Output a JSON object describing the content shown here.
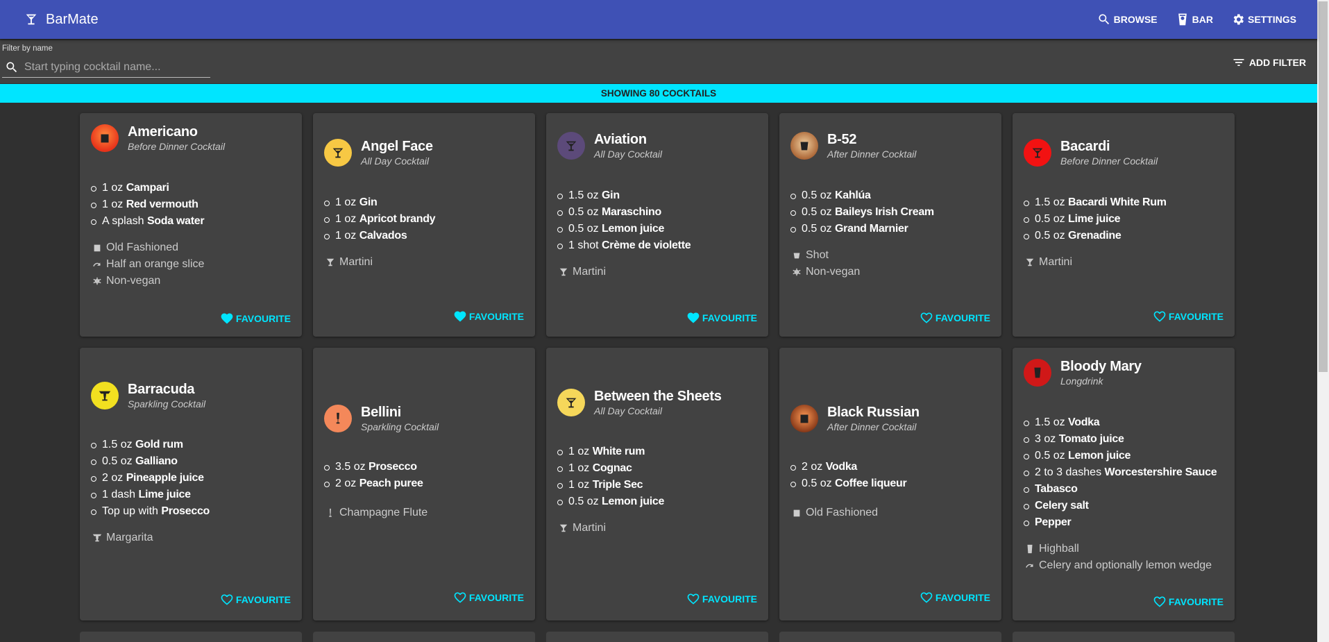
{
  "app": {
    "title": "BarMate"
  },
  "nav": [
    {
      "label": "BROWSE",
      "icon": "search-icon"
    },
    {
      "label": "BAR",
      "icon": "cup-icon"
    },
    {
      "label": "SETTINGS",
      "icon": "gear-icon"
    }
  ],
  "filter": {
    "label": "Filter by name",
    "placeholder": "Start typing cocktail name...",
    "add_filter": "ADD FILTER"
  },
  "banner": "SHOWING 80 COCKTAILS",
  "favourite_label": "FAVOURITE",
  "colors": {
    "appbar": "#3f51b5",
    "accent": "#00e5ff",
    "card": "#424242",
    "background": "#303030"
  },
  "cards": [
    {
      "name": "Americano",
      "category": "Before Dinner Cocktail",
      "glass_icon": "old-fashioned-glass-icon",
      "ingredients": [
        [
          "1 oz ",
          "Campari"
        ],
        [
          "1 oz ",
          "Red vermouth"
        ],
        [
          "A splash ",
          "Soda water"
        ]
      ],
      "meta": [
        [
          "glass",
          "Old Fashioned"
        ],
        [
          "garnish",
          "Half an orange slice"
        ],
        [
          "vegan",
          "Non-vegan"
        ]
      ],
      "favourite": true
    },
    {
      "name": "Angel Face",
      "category": "All Day Cocktail",
      "glass_icon": "martini-glass-icon",
      "ingredients": [
        [
          "1 oz ",
          "Gin"
        ],
        [
          "1 oz ",
          "Apricot brandy"
        ],
        [
          "1 oz ",
          "Calvados"
        ]
      ],
      "meta": [
        [
          "martini",
          "Martini"
        ]
      ],
      "favourite": true
    },
    {
      "name": "Aviation",
      "category": "All Day Cocktail",
      "glass_icon": "martini-glass-icon",
      "ingredients": [
        [
          "1.5 oz ",
          "Gin"
        ],
        [
          "0.5 oz ",
          "Maraschino"
        ],
        [
          "0.5 oz ",
          "Lemon juice"
        ],
        [
          "1 shot ",
          "Crème de violette"
        ]
      ],
      "meta": [
        [
          "martini",
          "Martini"
        ]
      ],
      "favourite": true
    },
    {
      "name": "B-52",
      "category": "After Dinner Cocktail",
      "glass_icon": "shot-glass-icon",
      "ingredients": [
        [
          "0.5 oz ",
          "Kahlúa"
        ],
        [
          "0.5 oz ",
          "Baileys Irish Cream"
        ],
        [
          "0.5 oz ",
          "Grand Marnier"
        ]
      ],
      "meta": [
        [
          "shot",
          "Shot"
        ],
        [
          "vegan",
          "Non-vegan"
        ]
      ],
      "favourite": false
    },
    {
      "name": "Bacardi",
      "category": "Before Dinner Cocktail",
      "glass_icon": "martini-glass-icon",
      "ingredients": [
        [
          "1.5 oz ",
          "Bacardi White Rum"
        ],
        [
          "0.5 oz ",
          "Lime juice"
        ],
        [
          "0.5 oz ",
          "Grenadine"
        ]
      ],
      "meta": [
        [
          "martini",
          "Martini"
        ]
      ],
      "favourite": false
    },
    {
      "name": "Barracuda",
      "category": "Sparkling Cocktail",
      "glass_icon": "margarita-glass-icon",
      "ingredients": [
        [
          "1.5 oz ",
          "Gold rum"
        ],
        [
          "0.5 oz ",
          "Galliano"
        ],
        [
          "2 oz ",
          "Pineapple juice"
        ],
        [
          "1 dash ",
          "Lime juice"
        ],
        [
          "Top up with ",
          "Prosecco"
        ]
      ],
      "meta": [
        [
          "margarita",
          "Margarita"
        ]
      ],
      "favourite": false
    },
    {
      "name": "Bellini",
      "category": "Sparkling Cocktail",
      "glass_icon": "champagne-flute-icon",
      "ingredients": [
        [
          "3.5 oz ",
          "Prosecco"
        ],
        [
          "2 oz ",
          "Peach puree"
        ]
      ],
      "meta": [
        [
          "flute",
          "Champagne Flute"
        ]
      ],
      "favourite": false
    },
    {
      "name": "Between the Sheets",
      "category": "All Day Cocktail",
      "glass_icon": "martini-glass-icon",
      "ingredients": [
        [
          "1 oz ",
          "White rum"
        ],
        [
          "1 oz ",
          "Cognac"
        ],
        [
          "1 oz ",
          "Triple Sec"
        ],
        [
          "0.5 oz ",
          "Lemon juice"
        ]
      ],
      "meta": [
        [
          "martini",
          "Martini"
        ]
      ],
      "favourite": false
    },
    {
      "name": "Black Russian",
      "category": "After Dinner Cocktail",
      "glass_icon": "old-fashioned-glass-icon",
      "ingredients": [
        [
          "2 oz ",
          "Vodka"
        ],
        [
          "0.5 oz ",
          "Coffee liqueur"
        ]
      ],
      "meta": [
        [
          "glass",
          "Old Fashioned"
        ]
      ],
      "favourite": false
    },
    {
      "name": "Bloody Mary",
      "category": "Longdrink",
      "glass_icon": "highball-glass-icon",
      "ingredients": [
        [
          "1.5 oz ",
          "Vodka"
        ],
        [
          "3 oz ",
          "Tomato juice"
        ],
        [
          "0.5 oz ",
          "Lemon juice"
        ],
        [
          "2 to 3 dashes ",
          "Worcestershire Sauce"
        ],
        [
          "",
          "Tabasco"
        ],
        [
          "",
          "Celery salt"
        ],
        [
          "",
          "Pepper"
        ]
      ],
      "meta": [
        [
          "highball",
          "Highball"
        ],
        [
          "garnish",
          "Celery and optionally lemon wedge"
        ]
      ],
      "favourite": false
    }
  ]
}
